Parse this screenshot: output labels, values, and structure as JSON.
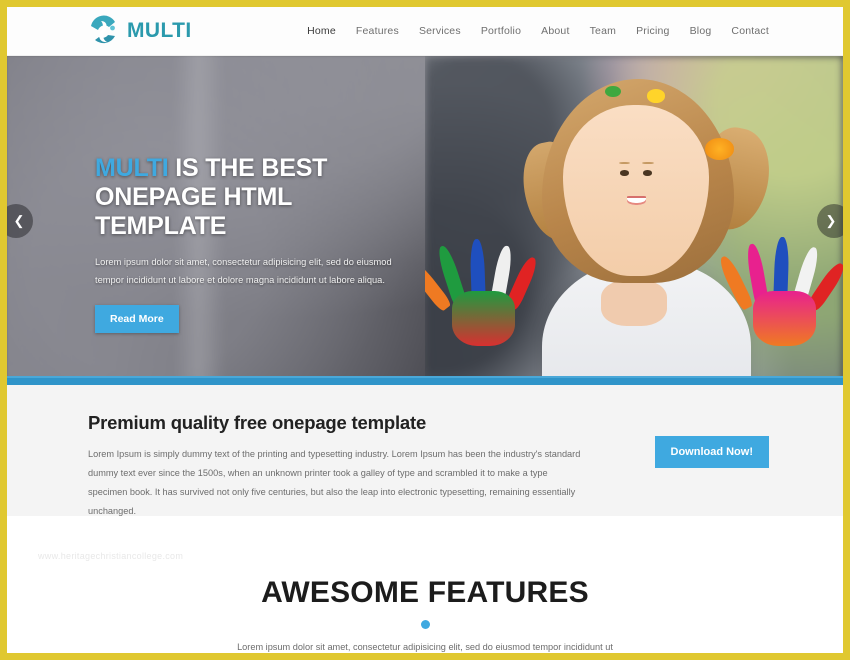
{
  "theme": {
    "page_border": "#e0c830",
    "accent_blue": "#3fa9e0",
    "brand_teal": "#2b9aad",
    "section_gray": "#f4f4f4"
  },
  "header": {
    "logo_icon": "swoosh-logo-icon",
    "brand_name": "MULTI",
    "nav": [
      {
        "label": "Home",
        "active": true
      },
      {
        "label": "Features",
        "active": false
      },
      {
        "label": "Services",
        "active": false
      },
      {
        "label": "Portfolio",
        "active": false
      },
      {
        "label": "About",
        "active": false
      },
      {
        "label": "Team",
        "active": false
      },
      {
        "label": "Pricing",
        "active": false
      },
      {
        "label": "Blog",
        "active": false
      },
      {
        "label": "Contact",
        "active": false
      }
    ]
  },
  "hero": {
    "title_accent": "MULTI",
    "title_rest": " IS THE BEST ONEPAGE HTML TEMPLATE",
    "subtitle": "Lorem ipsum dolor sit amet, consectetur adipisicing elit, sed do eiusmod tempor incididunt ut labore et dolore magna incididunt ut labore aliqua.",
    "cta_label": "Read More",
    "prev_icon": "chevron-left-icon",
    "next_icon": "chevron-right-icon",
    "image_alt": "smiling-girl-with-painted-hands"
  },
  "premium": {
    "title": "Premium quality free onepage template",
    "body": "Lorem Ipsum is simply dummy text of the printing and typesetting industry. Lorem Ipsum has been the industry's standard dummy text ever since the 1500s, when an unknown printer took a galley of type and scrambled it to make a type specimen book. It has survived not only five centuries, but also the leap into electronic typesetting, remaining essentially unchanged.",
    "cta_label": "Download Now!"
  },
  "features": {
    "title": "AWESOME FEATURES",
    "subtitle": "Lorem ipsum dolor sit amet, consectetur adipisicing elit, sed do eiusmod tempor incididunt ut"
  },
  "watermark": {
    "text": "www.heritagechristiancollege.com"
  }
}
